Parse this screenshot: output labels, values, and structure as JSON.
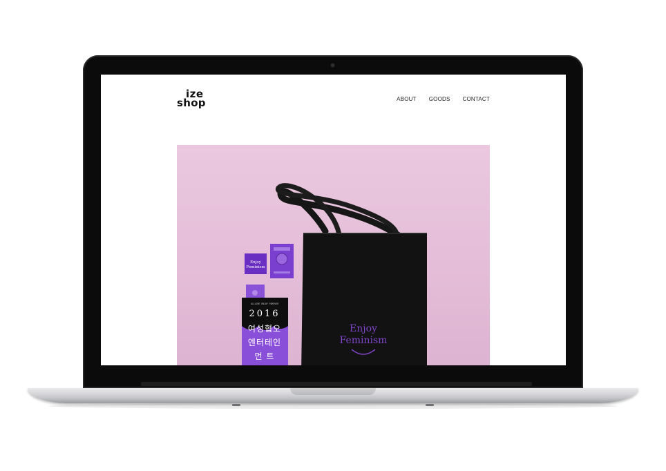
{
  "site": {
    "logo": {
      "line1": "ize",
      "line2": "shop"
    },
    "nav": [
      {
        "label": "ABOUT"
      },
      {
        "label": "GOODS"
      },
      {
        "label": "CONTACT"
      }
    ]
  },
  "hero": {
    "bag_text_1": "Enjoy",
    "bag_text_2": "Feminism",
    "badge_text_1": "Enjoy",
    "badge_text_2": "Feminism",
    "book_header": "ALLLOVE  ENJOY  FOREVER",
    "book_year": "2016",
    "book_line_1": "여성협오",
    "book_line_2": "엔터테인",
    "book_line_3": "먼  트",
    "colors": {
      "background": "#e8c4dc",
      "bag": "#111111",
      "purple": "#7a3fc9"
    }
  }
}
